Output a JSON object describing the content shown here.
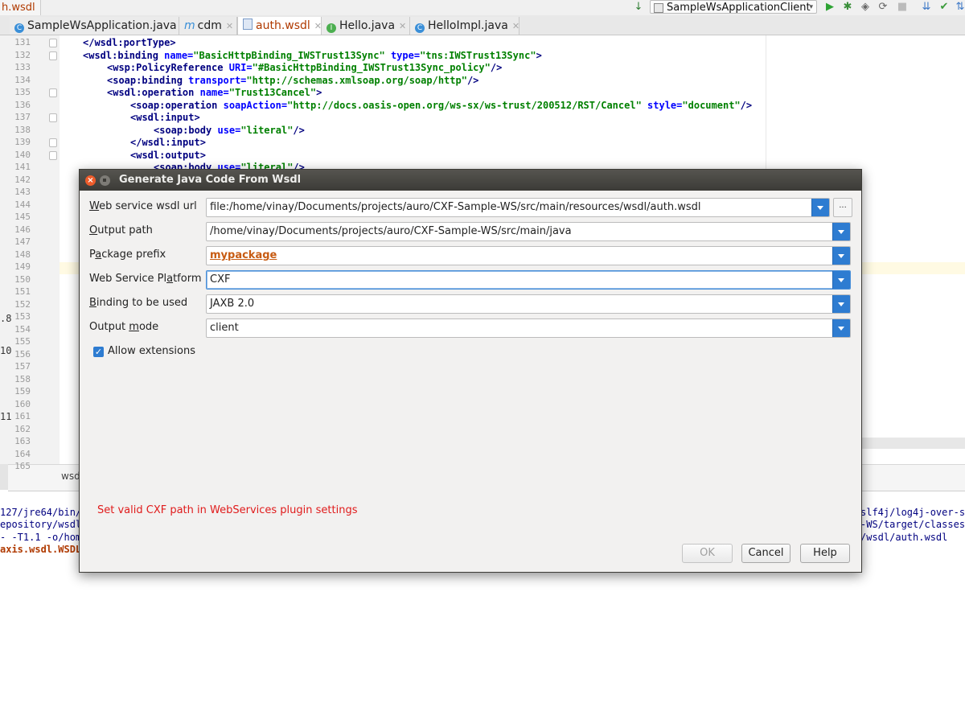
{
  "topbar": {
    "breadcrumb": "h.wsdl",
    "run_config": "SampleWsApplicationClient"
  },
  "tabs": [
    {
      "label": "SampleWsApplication.java",
      "icon": "class-icon"
    },
    {
      "label": "cdm",
      "icon": "module-icon"
    },
    {
      "label": "auth.wsdl",
      "icon": "wsdl-file-icon"
    },
    {
      "label": "Hello.java",
      "icon": "interface-icon"
    },
    {
      "label": "HelloImpl.java",
      "icon": "class-icon"
    }
  ],
  "editor": {
    "line_numbers": [
      "131",
      "132",
      "133",
      "134",
      "135",
      "136",
      "137",
      "138",
      "139",
      "140",
      "141",
      "142",
      "143",
      "144",
      "145",
      "146",
      "147",
      "148",
      "149",
      "150",
      "151",
      "152",
      "153",
      "154",
      "155",
      "156",
      "157",
      "158",
      "159",
      "160",
      "161",
      "162",
      "163",
      "164",
      "165"
    ],
    "lines": {
      "l131_tag": "</wsdl:portType>",
      "l132_tag": "<wsdl:binding",
      "l132_a1": "name=",
      "l132_v1": "\"BasicHttpBinding_IWSTrust13Sync\"",
      "l132_a2": "type=",
      "l132_v2": "\"tns:IWSTrust13Sync\"",
      "l132_end": ">",
      "l133_tag": "<wsp:PolicyReference",
      "l133_a1": "URI=",
      "l133_v1": "\"#BasicHttpBinding_IWSTrust13Sync_policy\"",
      "l133_end": "/>",
      "l134_tag": "<soap:binding",
      "l134_a1": "transport=",
      "l134_v1": "\"http://schemas.xmlsoap.org/soap/http\"",
      "l134_end": "/>",
      "l135_tag": "<wsdl:operation",
      "l135_a1": "name=",
      "l135_v1": "\"Trust13Cancel\"",
      "l135_end": ">",
      "l136_tag": "<soap:operation",
      "l136_a1": "soapAction=",
      "l136_v1": "\"http://docs.oasis-open.org/ws-sx/ws-trust/200512/RST/Cancel\"",
      "l136_a2": "style=",
      "l136_v2": "\"document\"",
      "l136_end": "/>",
      "l137_tag": "<wsdl:input>",
      "l138_tag": "<soap:body",
      "l138_a1": "use=",
      "l138_v1": "\"literal\"",
      "l138_end": "/>",
      "l139_tag": "</wsdl:input>",
      "l140_tag": "<wsdl:output>",
      "l141_tag": "<soap:body",
      "l141_a1": "use=",
      "l141_v1": "\"literal\"",
      "l141_end": "/>"
    },
    "bottom_tab": "wsdl",
    "left_fragments": [
      ".8",
      "10",
      "11"
    ]
  },
  "console": {
    "left": [
      "127/jre64/bin/",
      "epository/wsdl",
      "- -T1.1 -o/home",
      "axis.wsdl.WSDL"
    ],
    "right": [
      "slf4j/log4j-over-s",
      "-WS/target/classes",
      "/wsdl/auth.wsdl"
    ]
  },
  "dialog": {
    "title": "Generate Java Code From Wsdl",
    "fields": {
      "wsdl_url": {
        "label_pre": "",
        "label_key": "W",
        "label_post": "eb service wsdl url",
        "value": "file:/home/vinay/Documents/projects/auro/CXF-Sample-WS/src/main/resources/wsdl/auth.wsdl"
      },
      "output_path": {
        "label_pre": "",
        "label_key": "O",
        "label_post": "utput path",
        "value": "/home/vinay/Documents/projects/auro/CXF-Sample-WS/src/main/java"
      },
      "package_prefix": {
        "label_pre": "P",
        "label_key": "a",
        "label_post": "ckage prefix",
        "value": "mypackage"
      },
      "platform": {
        "label_pre": "Web Service Pl",
        "label_key": "a",
        "label_post": "tform",
        "value": "CXF"
      },
      "binding": {
        "label_pre": "",
        "label_key": "B",
        "label_post": "inding to be used",
        "value": "JAXB 2.0"
      },
      "output_mode": {
        "label_pre": "Output ",
        "label_key": "m",
        "label_post": "ode",
        "value": "client"
      }
    },
    "browse_label": "...",
    "allow_extensions": {
      "label": "Allow extensions",
      "checked": true
    },
    "error_message": "Set valid CXF path in WebServices plugin settings",
    "buttons": {
      "ok": "OK",
      "cancel": "Cancel",
      "help": "Help"
    }
  },
  "colors": {
    "accent": "#2e7cd1",
    "error_text": "#e01b1b",
    "titlebar": "#3c3b37",
    "close_button": "#ee5c2b"
  }
}
